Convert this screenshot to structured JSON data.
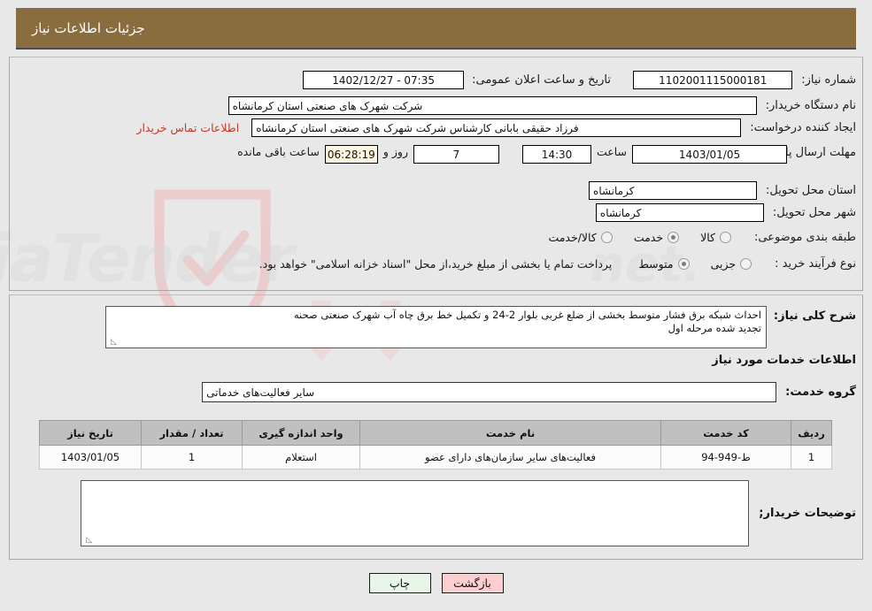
{
  "header": {
    "title": "جزئیات اطلاعات نیاز"
  },
  "info": {
    "need_number_label": "شماره نیاز:",
    "need_number_value": "1102001115000181",
    "announce_datetime_label": "تاریخ و ساعت اعلان عمومی:",
    "announce_datetime_value": "07:35 - 1402/12/27",
    "buyer_org_label": "نام دستگاه خریدار:",
    "buyer_org_value": "شرکت شهرک های صنعتی استان کرمانشاه",
    "requester_label": "ایجاد کننده درخواست:",
    "requester_value": "فرزاد حقیقی بابانی کارشناس شرکت شهرک های صنعتی استان کرمانشاه",
    "contact_link": "اطلاعات تماس خریدار",
    "deadline_label": "مهلت ارسال پاسخ: تا تاریخ:",
    "deadline_date": "1403/01/05",
    "deadline_hour_label": "ساعت",
    "deadline_hour_value": "14:30",
    "remaining_days": "7",
    "remaining_days_label": "روز و",
    "remaining_time": "06:28:19",
    "remaining_time_label": "ساعت باقی مانده",
    "province_label": "استان محل تحویل:",
    "province_value": "کرمانشاه",
    "city_label": "شهر محل تحویل:",
    "city_value": "کرمانشاه",
    "category_label": "طبقه بندی موضوعی:",
    "category_options": [
      {
        "label": "کالا",
        "selected": false
      },
      {
        "label": "خدمت",
        "selected": true
      },
      {
        "label": "کالا/خدمت",
        "selected": false
      }
    ],
    "process_label": "نوع فرآیند خرید :",
    "process_options": [
      {
        "label": "جزیی",
        "selected": false
      },
      {
        "label": "متوسط",
        "selected": true
      }
    ],
    "payment_note": "پرداخت تمام یا بخشی از مبلغ خرید،از محل \"اسناد خزانه اسلامی\" خواهد بود."
  },
  "details": {
    "summary_label": "شرح کلی نیاز:",
    "summary_line1": "احداث شبکه برق فشار متوسط بخشی از ضلع غربی بلوار 2-24 و تکمیل خط برق چاه آب شهرک صنعتی صحنه",
    "summary_line2": "تجدید شده مرحله اول",
    "services_title": "اطلاعات خدمات مورد نیاز",
    "service_group_label": "گروه خدمت:",
    "service_group_value": "سایر فعالیت‌های خدماتی",
    "table": {
      "headers": [
        "ردیف",
        "کد خدمت",
        "نام خدمت",
        "واحد اندازه گیری",
        "تعداد / مقدار",
        "تاریخ نیاز"
      ],
      "rows": [
        {
          "index": "1",
          "code": "ط-949-94",
          "name": "فعالیت‌های سایر سازمان‌های دارای عضو",
          "unit": "استعلام",
          "quantity": "1",
          "date": "1403/01/05"
        }
      ]
    },
    "buyer_notes_label": "توضیحات خریدار;",
    "buyer_notes_value": ""
  },
  "footer": {
    "print_label": "چاپ",
    "back_label": "بازگشت"
  }
}
